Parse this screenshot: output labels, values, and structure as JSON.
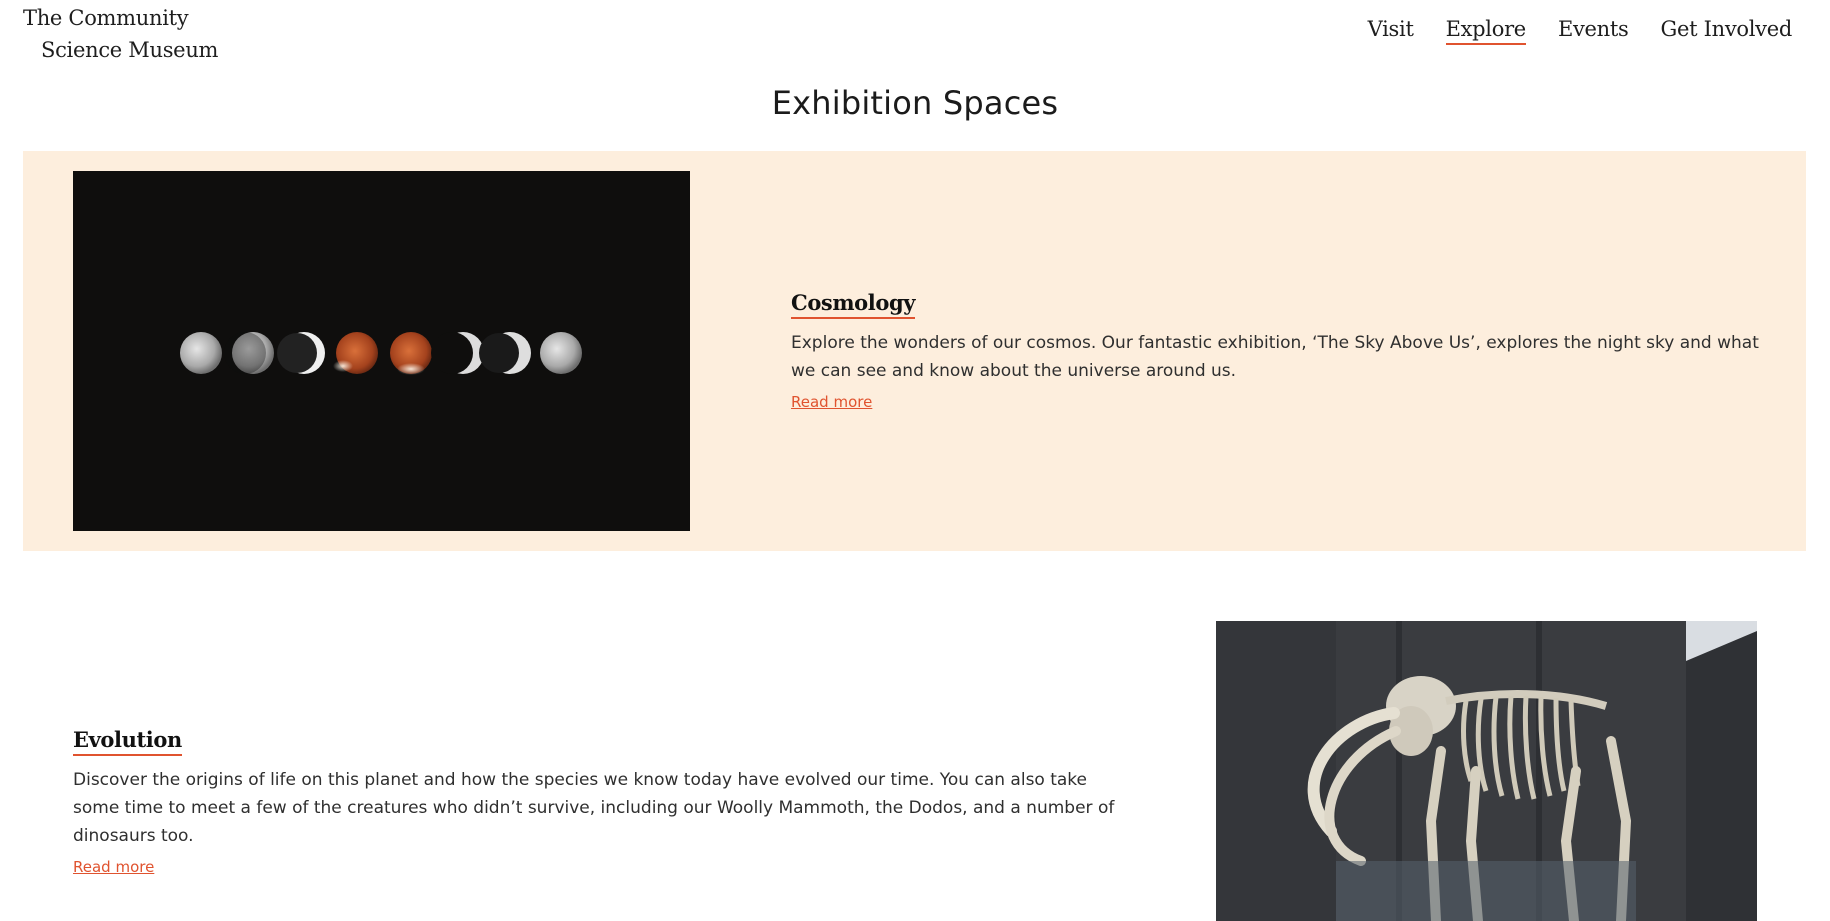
{
  "logo": {
    "line1": "The Community",
    "line2": "Science Museum"
  },
  "nav": {
    "items": [
      {
        "label": "Visit",
        "active": false
      },
      {
        "label": "Explore",
        "active": true
      },
      {
        "label": "Events",
        "active": false
      },
      {
        "label": "Get Involved",
        "active": false
      }
    ]
  },
  "page": {
    "title": "Exhibition Spaces"
  },
  "exhibits": [
    {
      "title": "Cosmology",
      "description": "Explore the wonders of our cosmos. Our fantastic exhibition, ‘The Sky Above Us’, explores the night sky and what we can see and know about the universe around us.",
      "link": "Read more",
      "image": "lunar-eclipse-phases"
    },
    {
      "title": "Evolution",
      "description": "Discover the origins of life on this planet and how the species we know today have evolved our time. You can also take some time to meet a few of the creatures who didn’t survive, including our Woolly Mammoth, the Dodos, and a number of dinosaurs too.",
      "link": "Read more",
      "image": "mammoth-skeleton"
    }
  ],
  "colors": {
    "accent": "#e0532f",
    "highlight_band": "#fdeedd",
    "text": "#2f2f2f"
  }
}
